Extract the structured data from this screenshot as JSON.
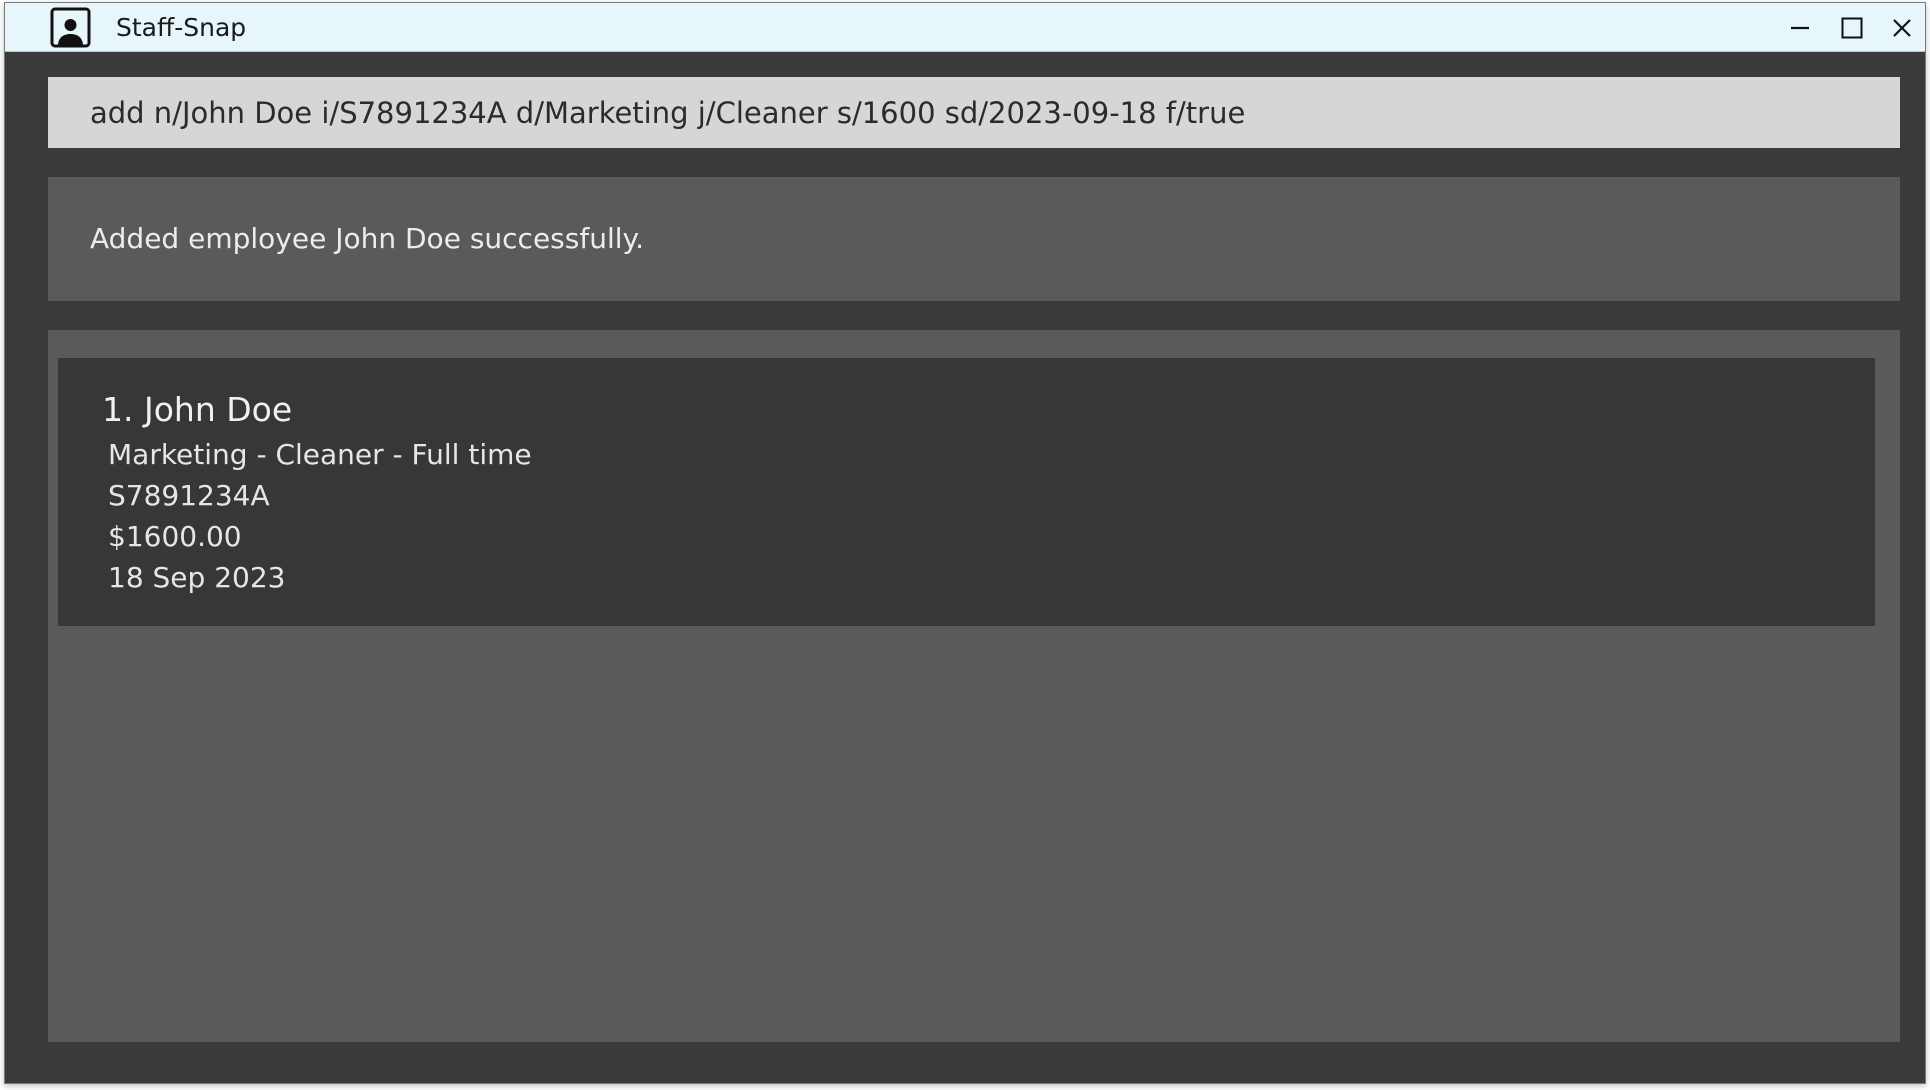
{
  "window": {
    "title": "Staff-Snap",
    "icons": {
      "app": "staff-person-icon",
      "minimize": "minimize-icon",
      "maximize": "maximize-icon",
      "close": "close-icon"
    },
    "colors": {
      "titlebar": "#e6f6fb",
      "background": "#3a3a3a",
      "panel": "#5a5a5a",
      "card": "#373737",
      "command_box": "#d6d6d6"
    }
  },
  "command": {
    "value": "add n/John Doe i/S7891234A d/Marketing j/Cleaner s/1600 sd/2023-09-18 f/true"
  },
  "result": {
    "message": "Added employee John Doe successfully."
  },
  "employees": [
    {
      "title": "1. John Doe",
      "summary": "Marketing - Cleaner - Full time",
      "id": "S7891234A",
      "salary": "$1600.00",
      "start_date": "18 Sep 2023"
    }
  ]
}
